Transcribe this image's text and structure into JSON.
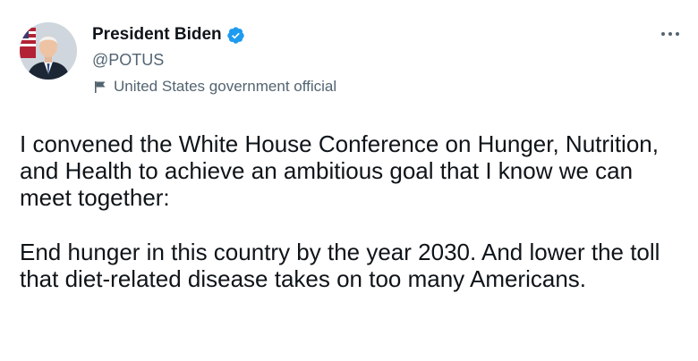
{
  "author": {
    "display_name": "President Biden",
    "handle": "@POTUS",
    "verified": true,
    "label": "United States government official",
    "avatar_icon": "portrait-avatar"
  },
  "menu": {
    "icon": "more-horizontal-icon"
  },
  "tweet": {
    "paragraphs": [
      "I convened the White House Conference on Hunger, Nutrition, and Health to achieve an ambitious goal that I know we can meet together:",
      "End hunger in this country by the year 2030. And lower the toll that diet-related disease takes on too many Americans."
    ]
  },
  "colors": {
    "verified_blue": "#1d9bf0",
    "secondary_text": "#536471",
    "primary_text": "#0f1419"
  }
}
